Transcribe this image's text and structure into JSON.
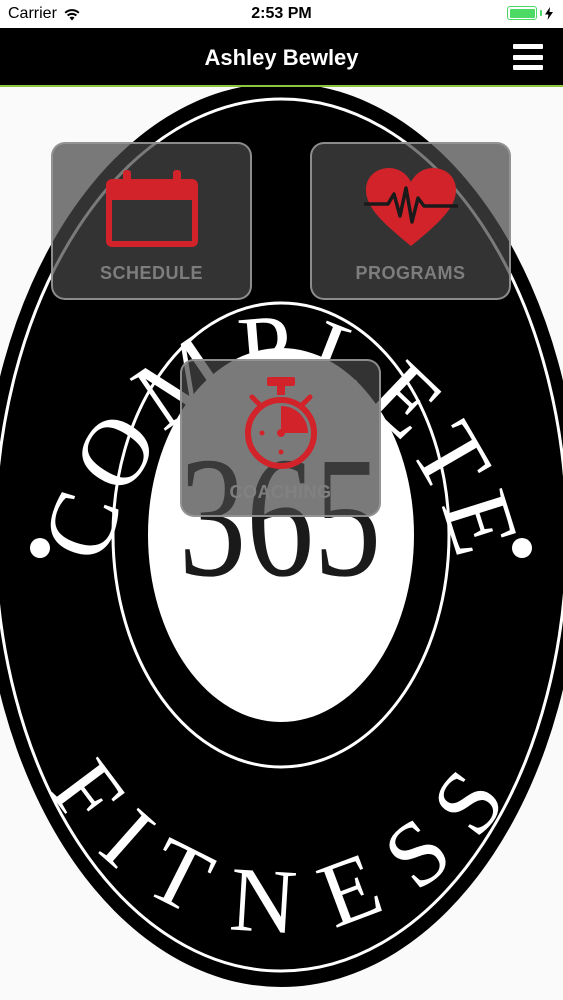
{
  "status_bar": {
    "carrier": "Carrier",
    "time": "2:53 PM",
    "battery_level": 1.0
  },
  "nav": {
    "title": "Ashley Bewley"
  },
  "logo": {
    "top_text": "COMPLETE",
    "bottom_text": "FITNESS",
    "center_text": "365"
  },
  "tiles": [
    {
      "label": "SCHEDULE",
      "icon": "calendar-icon"
    },
    {
      "label": "PROGRAMS",
      "icon": "heartbeat-icon"
    },
    {
      "label": "COACHING",
      "icon": "stopwatch-icon"
    }
  ],
  "colors": {
    "accent": "#d2232a",
    "nav_background": "#000000",
    "nav_border": "#8dc63f",
    "battery": "#4cd964"
  }
}
